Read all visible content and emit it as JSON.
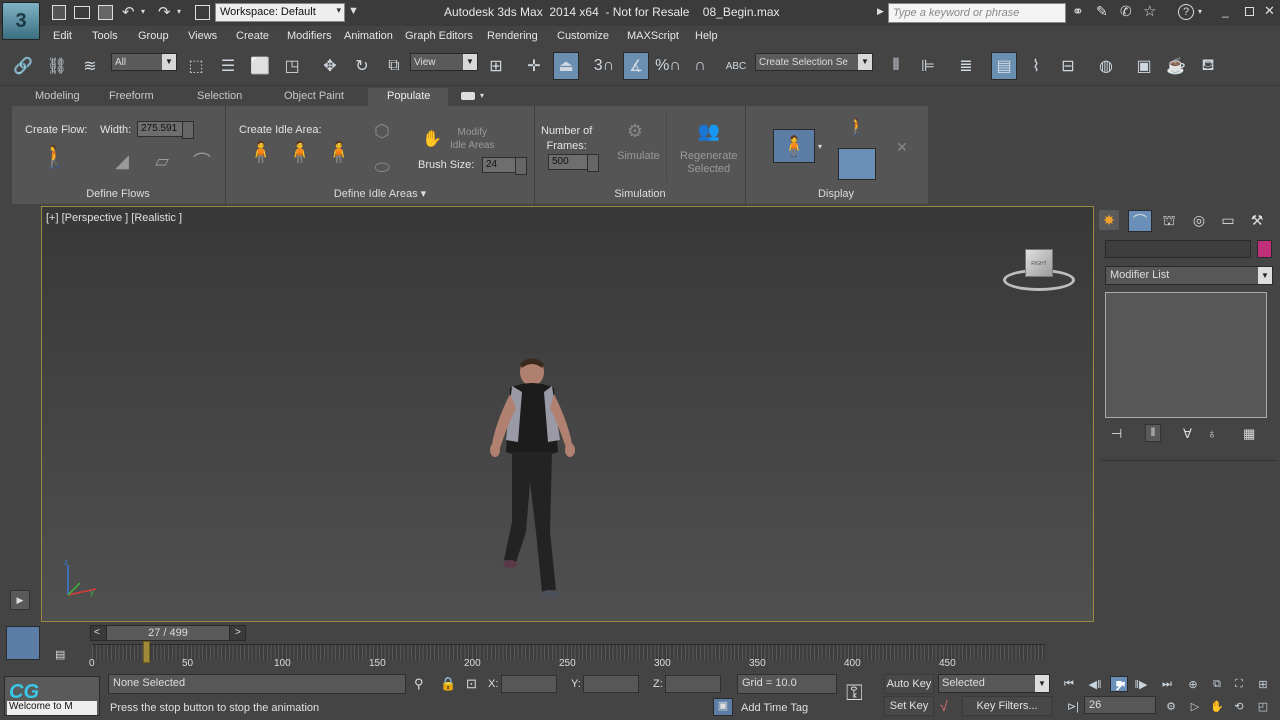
{
  "title_bar": {
    "workspace": "Workspace: Default",
    "title": "Autodesk 3ds Max  2014 x64  - Not for Resale    08_Begin.max",
    "search_placeholder": "Type a keyword or phrase"
  },
  "menu": [
    "Edit",
    "Tools",
    "Group",
    "Views",
    "Create",
    "Modifiers",
    "Animation",
    "Graph Editors",
    "Rendering",
    "Customize",
    "MAXScript",
    "Help"
  ],
  "main_toolbar": {
    "filter": "All",
    "ref_coord": "View",
    "selection_set": "Create Selection Se",
    "snap_labels": [
      "3",
      "%",
      "ABC"
    ]
  },
  "ribbon_tabs": [
    "Modeling",
    "Freeform",
    "Selection",
    "Object Paint",
    "Populate"
  ],
  "ribbon": {
    "create_flow": "Create Flow:",
    "width_label": "Width:",
    "width_value": "275.591",
    "define_flows": "Define Flows",
    "create_idle_area": "Create Idle Area:",
    "modify_idle_areas": "Modify\nIdle Areas",
    "brush_size_label": "Brush Size:",
    "brush_size_value": "24",
    "define_idle_areas": "Define Idle Areas",
    "num_frames_label": "Number of\nFrames:",
    "num_frames_value": "500",
    "simulate": "Simulate",
    "regenerate_selected": "Regenerate\nSelected",
    "simulation": "Simulation",
    "display": "Display"
  },
  "viewport": {
    "label": "[+] [Perspective ] [Realistic ]",
    "viewcube_label": "RIGHT"
  },
  "command_panel": {
    "modifier_list": "Modifier List",
    "accent_color": "#c0307a"
  },
  "timeline": {
    "frame_display": "27 / 499",
    "prev": "<",
    "next": ">",
    "current_frame_fraction": 0.054,
    "ticks": [
      "0",
      "50",
      "100",
      "150",
      "200",
      "250",
      "300",
      "350",
      "400",
      "450"
    ]
  },
  "status": {
    "selection": "None Selected",
    "prompt": "Press the stop button to stop the animation",
    "welcome": "Welcome to M",
    "x_label": "X:",
    "y_label": "Y:",
    "z_label": "Z:",
    "grid": "Grid = 10.0",
    "add_time_tag": "Add Time Tag",
    "auto_key": "Auto Key",
    "set_key": "Set Key",
    "key_mode": "Selected",
    "key_filters": "Key Filters...",
    "current_frame": "26"
  },
  "watermark": "CG"
}
